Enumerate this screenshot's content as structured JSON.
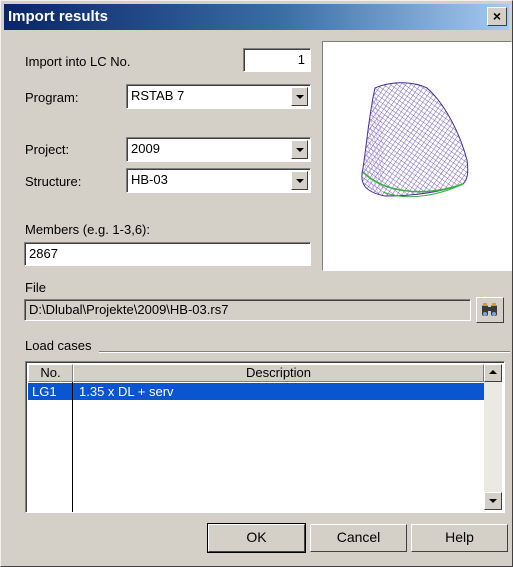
{
  "window": {
    "title": "Import results",
    "close_symbol": "×"
  },
  "form": {
    "import_into_lc_label": "Import into LC No.",
    "import_into_lc_value": "1",
    "program_label": "Program:",
    "program_value": "RSTAB 7",
    "project_label": "Project:",
    "project_value": "2009",
    "structure_label": "Structure:",
    "structure_value": "HB-03",
    "members_label": "Members (e.g. 1-3,6):",
    "members_value": "2867"
  },
  "file": {
    "label": "File",
    "path": "D:\\Dlubal\\Projekte\\2009\\HB-03.rs7",
    "browse_icon": "binoculars-icon"
  },
  "load_cases": {
    "label": "Load cases",
    "columns": [
      "No.",
      "Description"
    ],
    "rows": [
      {
        "no": "LG1",
        "description": "1.35 x DL + serv"
      }
    ]
  },
  "buttons": {
    "ok": "OK",
    "cancel": "Cancel",
    "help": "Help"
  },
  "colors": {
    "title_gradient_start": "#0a246a",
    "selection": "#0a55d0",
    "mesh": "#5b3fa8",
    "mesh_edge": "#3cb043"
  }
}
